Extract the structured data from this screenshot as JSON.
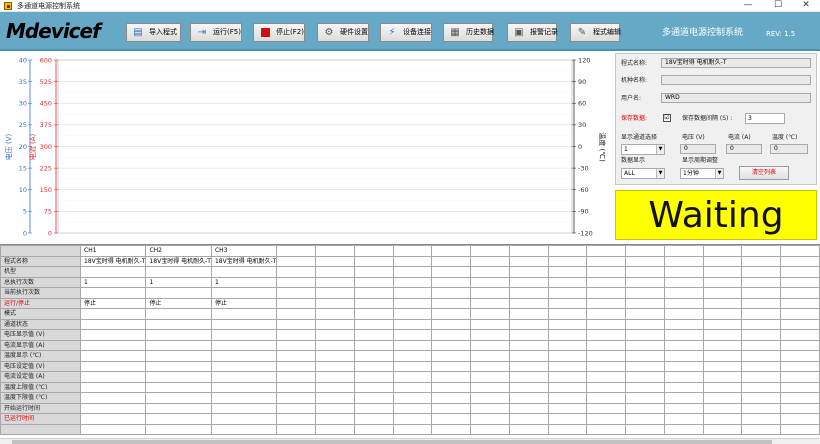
{
  "window": {
    "title": "多通道电源控制系统",
    "minimize": "—",
    "maximize": "☐",
    "close": "✕"
  },
  "logo": {
    "m": "M",
    "rest": "devicef"
  },
  "toolbar": {
    "buttons": [
      {
        "label": "导入程式",
        "icon": "import-icon"
      },
      {
        "label": "运行(F5)",
        "icon": "run-icon"
      },
      {
        "label": "停止(F2)",
        "icon": "stop-icon"
      },
      {
        "label": "硬件设置",
        "icon": "gear-icon"
      },
      {
        "label": "设备连接",
        "icon": "connect-icon"
      },
      {
        "label": "历史数据",
        "icon": "history-icon"
      },
      {
        "label": "报警记录",
        "icon": "alarm-record-icon"
      },
      {
        "label": "程式编辑",
        "icon": "edit-program-icon"
      }
    ],
    "system_title": "多通道电源控制系统",
    "revision": "REV: 1.5"
  },
  "chart": {
    "left_axis1_label": "电压 (V)",
    "left_axis2_label": "电流 (A)",
    "right_axis_label": "温度 (℃)",
    "accent": "#e03030"
  },
  "chart_data": {
    "type": "line",
    "series": [],
    "voltage_axis": {
      "ylim": [
        0,
        40
      ],
      "ticks": [
        "40",
        "35",
        "30",
        "25",
        "20",
        "15",
        "10",
        "5",
        "0"
      ]
    },
    "current_axis": {
      "ylim": [
        0,
        600
      ],
      "ticks": [
        "600",
        "525",
        "450",
        "375",
        "300",
        "225",
        "150",
        "75",
        "0"
      ]
    },
    "temperature_axis": {
      "ylim": [
        -120,
        120
      ],
      "ticks": [
        "120",
        "90",
        "60",
        "30",
        "0",
        "-30",
        "-60",
        "-90",
        "-120"
      ]
    },
    "grid": true
  },
  "panel": {
    "program_name_label": "程式名称:",
    "program_name_value": "18V宝时得 电机耐久-T",
    "model_label": "机种名称:",
    "model_value": "",
    "user_label": "用户名:",
    "user_value": "WRD",
    "save_data_label": "保存数据:",
    "save_checked": "☑",
    "save_interval_label": "保存数据间隔 (S) :",
    "save_interval_value": "3",
    "display_channel_label": "显示通道选择",
    "display_channel_value": "1",
    "voltage_label": "电压 (V)",
    "voltage_value": "0",
    "current_label": "电流 (A)",
    "current_value": "0",
    "temperature_label": "温度 (℃)",
    "temperature_value": "0",
    "data_display_label": "数据显示",
    "data_display_value": "ALL",
    "display_period_label": "显示周期调整",
    "display_period_value": "1分钟",
    "clear_button": "清空列表"
  },
  "status": {
    "text": "Waiting",
    "color": "#ffff00"
  },
  "table": {
    "channels": [
      "CH1",
      "CH2",
      "CH3"
    ],
    "rows": [
      {
        "label": "程式名称",
        "red": false,
        "values": [
          "18V宝时得 电机耐久-T",
          "18V宝时得 电机耐久-T",
          "18V宝时得 电机耐久-T"
        ]
      },
      {
        "label": "机型",
        "red": false,
        "values": [
          "",
          "",
          ""
        ]
      },
      {
        "label": "总执行次数",
        "red": false,
        "values": [
          "1",
          "1",
          "1"
        ]
      },
      {
        "label": "当前执行次数",
        "red": false,
        "values": [
          "",
          "",
          ""
        ]
      },
      {
        "label": "运行/停止",
        "red": true,
        "values": [
          "停止",
          "停止",
          "停止"
        ]
      },
      {
        "label": "模式",
        "red": false,
        "values": [
          "",
          "",
          ""
        ]
      },
      {
        "label": "通道状态",
        "red": false,
        "values": [
          "",
          "",
          ""
        ]
      },
      {
        "label": "电压显示值 (V)",
        "red": false,
        "values": [
          "",
          "",
          ""
        ]
      },
      {
        "label": "电流显示值 (A)",
        "red": false,
        "values": [
          "",
          "",
          ""
        ]
      },
      {
        "label": "温度显示 (℃)",
        "red": false,
        "values": [
          "",
          "",
          ""
        ]
      },
      {
        "label": "电压设定值 (V)",
        "red": false,
        "values": [
          "",
          "",
          ""
        ]
      },
      {
        "label": "电流设定值 (A)",
        "red": false,
        "values": [
          "",
          "",
          ""
        ]
      },
      {
        "label": "温度上限值 (℃)",
        "red": false,
        "values": [
          "",
          "",
          ""
        ]
      },
      {
        "label": "温度下限值 (℃)",
        "red": false,
        "values": [
          "",
          "",
          ""
        ]
      },
      {
        "label": "开始运行时间",
        "red": false,
        "values": [
          "",
          "",
          ""
        ]
      },
      {
        "label": "已运行时间",
        "red": true,
        "values": [
          "",
          "",
          ""
        ]
      },
      {
        "label": "",
        "red": false,
        "values": [
          "",
          "",
          ""
        ]
      }
    ]
  }
}
